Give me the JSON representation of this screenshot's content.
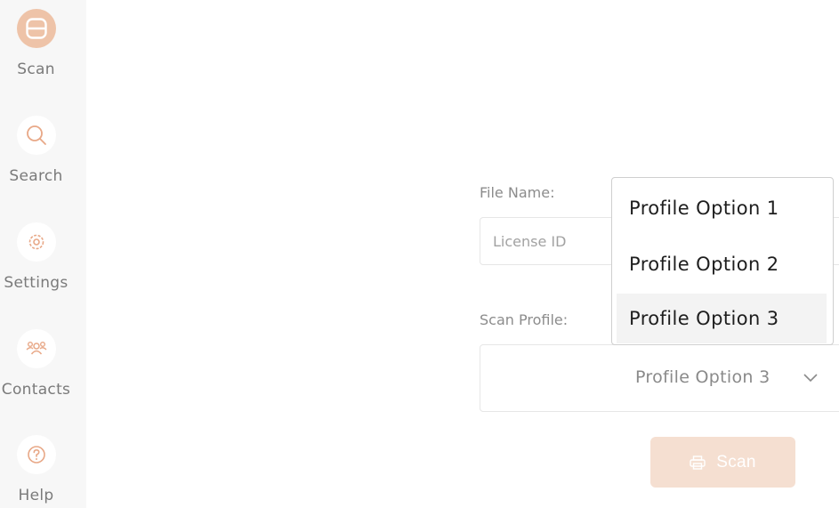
{
  "sidebar": {
    "items": [
      {
        "label": "Scan",
        "icon": "scan-icon",
        "active": true
      },
      {
        "label": "Search",
        "icon": "search-icon",
        "active": false
      },
      {
        "label": "Settings",
        "icon": "gear-icon",
        "active": false
      },
      {
        "label": "Contacts",
        "icon": "contacts-icon",
        "active": false
      },
      {
        "label": "Help",
        "icon": "help-icon",
        "active": false
      }
    ]
  },
  "form": {
    "file_name_label": "File Name:",
    "file_name_placeholder": "License ID",
    "file_name_value": "",
    "scan_profile_label": "Scan Profile:",
    "scan_profile_value": "Profile Option 3",
    "scan_button_label": "Scan"
  },
  "dropdown": {
    "options": [
      "Profile Option 1",
      "Profile Option 2",
      "Profile Option 3"
    ],
    "selected_index": 2
  },
  "colors": {
    "accent": "#eec3a8",
    "icon_accent": "#e8a887",
    "button_disabled": "#f5dfd1",
    "sidebar_bg": "#f7f7f7"
  }
}
